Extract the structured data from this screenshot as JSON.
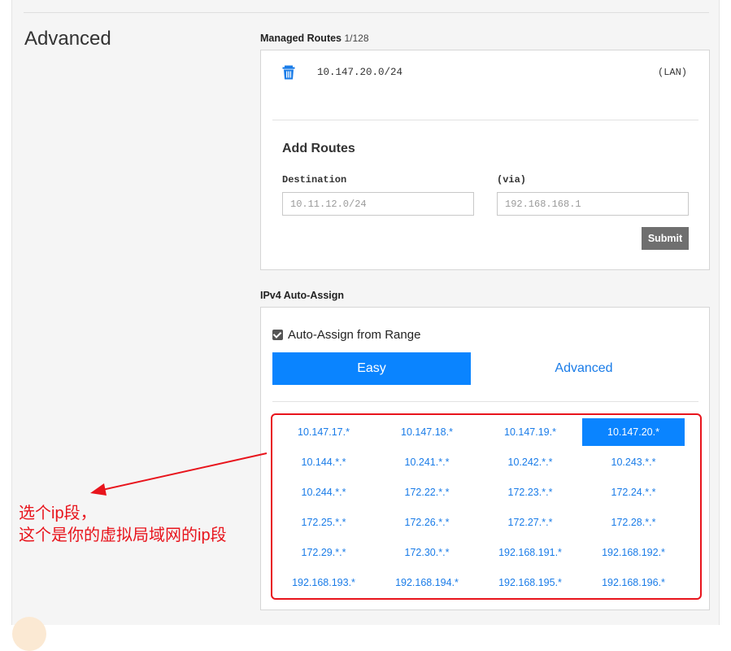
{
  "section": {
    "title": "Advanced"
  },
  "managed_routes": {
    "label": "Managed Routes",
    "count": "1/128",
    "routes": [
      {
        "destination": "10.147.20.0/24",
        "via": "(LAN)",
        "icon": "trash-icon"
      }
    ]
  },
  "add_routes": {
    "title": "Add Routes",
    "destination_label": "Destination",
    "destination_placeholder": "10.11.12.0/24",
    "via_label": "(via)",
    "via_placeholder": "192.168.168.1",
    "submit_label": "Submit"
  },
  "auto_assign": {
    "label": "IPv4 Auto-Assign",
    "checkbox_label": "Auto-Assign from Range",
    "checked": true,
    "tabs": [
      "Easy",
      "Advanced"
    ],
    "active_tab": "Easy",
    "ranges": [
      "10.147.17.*",
      "10.147.18.*",
      "10.147.19.*",
      "10.147.20.*",
      "10.144.*.*",
      "10.241.*.*",
      "10.242.*.*",
      "10.243.*.*",
      "10.244.*.*",
      "172.22.*.*",
      "172.23.*.*",
      "172.24.*.*",
      "172.25.*.*",
      "172.26.*.*",
      "172.27.*.*",
      "172.28.*.*",
      "172.29.*.*",
      "172.30.*.*",
      "192.168.191.*",
      "192.168.192.*",
      "192.168.193.*",
      "192.168.194.*",
      "192.168.195.*",
      "192.168.196.*"
    ],
    "selected_range": "10.147.20.*"
  },
  "annotation": {
    "line1": "选个ip段，",
    "line2": "这个是你的虚拟局域网的ip段",
    "color": "#e8141c"
  },
  "colors": {
    "accent": "#0a84ff",
    "link": "#1a7ce8",
    "submit": "#6f6f6f"
  }
}
